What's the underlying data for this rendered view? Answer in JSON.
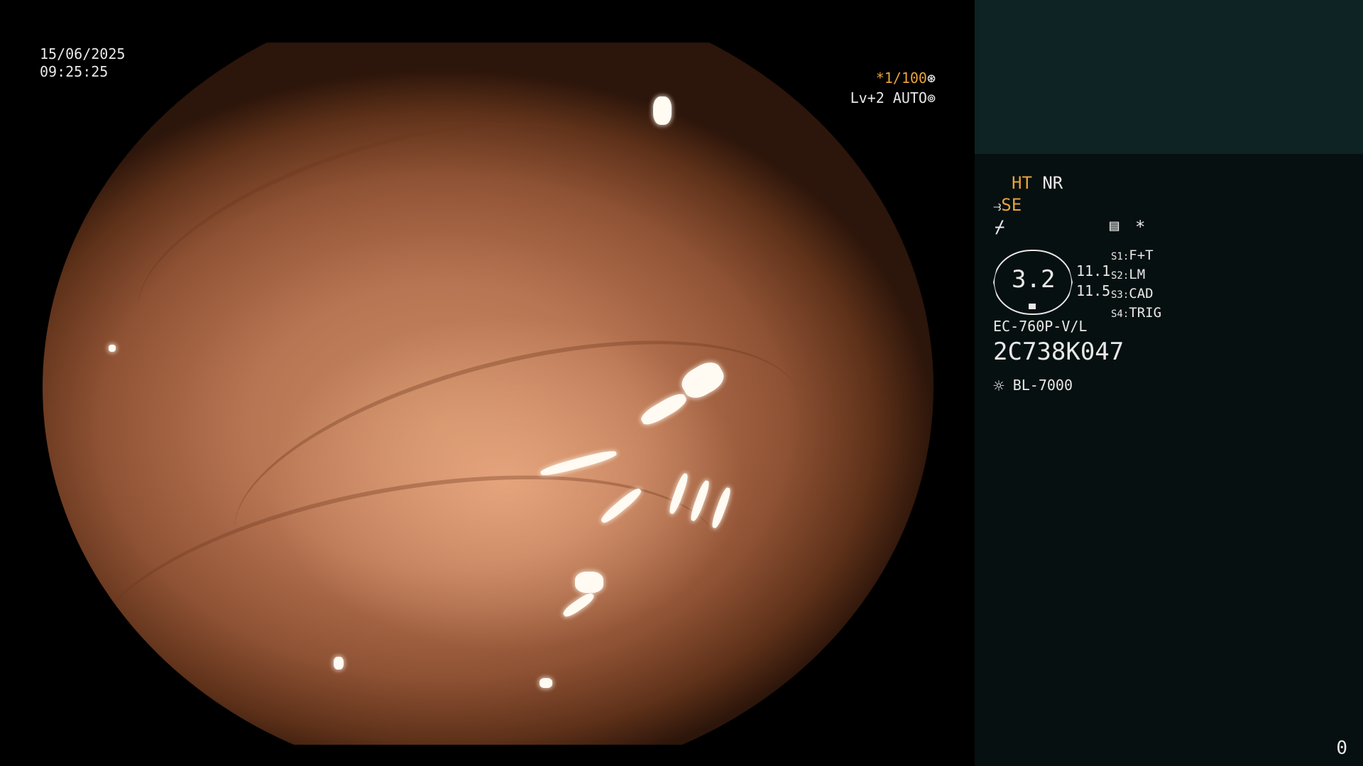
{
  "viewport": {
    "date": "15/06/2025",
    "time": "09:25:25",
    "shutter": "*1/100",
    "shutter_icon": "aperture-icon",
    "level": "Lv+2 AUTO",
    "level_icon": "iris-icon",
    "colors": {
      "accent": "#e9a23b",
      "text": "#e8e8e8"
    }
  },
  "sidebar": {
    "ht": "HT",
    "nr": "NR",
    "se": "SE",
    "se_icon": "enhance-icon",
    "freeze_icon": "slash-icon",
    "memo_icon": "memo-icon",
    "star": "*",
    "scope_value": "3.2",
    "diam_1": "11.1",
    "diam_2": "11.5",
    "switches": [
      {
        "key": "S1:",
        "value": "F+T"
      },
      {
        "key": "S2:",
        "value": "LM"
      },
      {
        "key": "S3:",
        "value": "CAD"
      },
      {
        "key": "S4:",
        "value": "TRIG"
      }
    ],
    "scope_model": "EC-760P-V/L",
    "serial": "2C738K047",
    "light_icon": "sun-icon",
    "light_source": "BL-7000",
    "counter": "0",
    "colors": {
      "panel_top": "#0d2324",
      "panel": "#071010"
    }
  }
}
